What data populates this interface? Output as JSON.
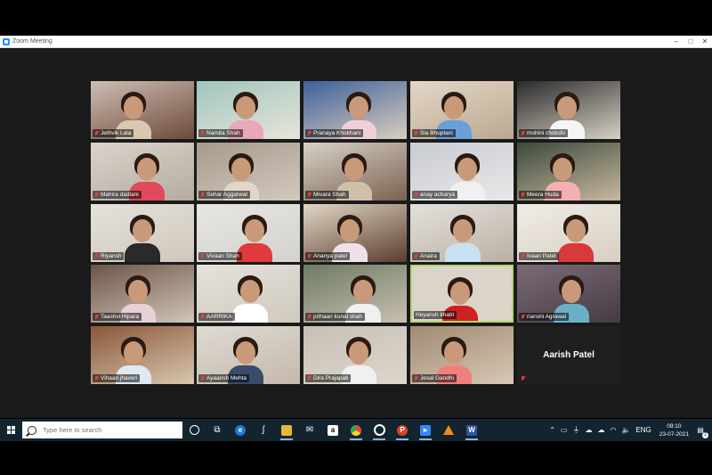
{
  "window": {
    "title": "Zoom Meeting",
    "minimize": "–",
    "maximize": "□",
    "close": "✕"
  },
  "participants": [
    {
      "name": "Jethvik Lala",
      "muted": true
    },
    {
      "name": "Namita Shah",
      "muted": true
    },
    {
      "name": "Pranaya Khokhani",
      "muted": true
    },
    {
      "name": "Sia Bhuptani",
      "muted": true
    },
    {
      "name": "mohini chokshi",
      "muted": true
    },
    {
      "name": "Mahira dadlani",
      "muted": true
    },
    {
      "name": "Sehar Aggarwal",
      "muted": true
    },
    {
      "name": "Mivara Shah",
      "muted": true
    },
    {
      "name": "anay acharya",
      "muted": true
    },
    {
      "name": "Meera Huda",
      "muted": true
    },
    {
      "name": "Riyansh",
      "muted": true
    },
    {
      "name": "Vivaan Shah",
      "muted": true
    },
    {
      "name": "Ananya patel",
      "muted": true
    },
    {
      "name": "Anaira",
      "muted": true
    },
    {
      "name": "Ivaan Patel",
      "muted": true
    },
    {
      "name": "Taashvi Hipara",
      "muted": true
    },
    {
      "name": "AARRIKA",
      "muted": true
    },
    {
      "name": "prihaan kunal shah",
      "muted": true
    },
    {
      "name": "Heyansh khatri",
      "muted": false,
      "active_speaker": true
    },
    {
      "name": "rianshi Agrawal",
      "muted": true
    },
    {
      "name": "Vihaan jhaveri",
      "muted": true
    },
    {
      "name": "Ayaansh Mehta",
      "muted": true
    },
    {
      "name": "Dira Prajapati",
      "muted": true
    },
    {
      "name": "Jesal Gandhi",
      "muted": true
    },
    {
      "name": "Aarish Patel",
      "muted": true,
      "video_off": true
    }
  ],
  "taskbar": {
    "search_placeholder": "Type here to search",
    "icons": [
      "cortana-icon",
      "task-view-icon",
      "edge-icon",
      "app-icon",
      "file-explorer-icon",
      "mail-icon",
      "amazon-icon",
      "chrome-icon",
      "media-icon",
      "powerpoint-icon",
      "zoom-icon",
      "vlc-icon",
      "word-icon"
    ],
    "tray": {
      "language": "ENG",
      "time": "09:10",
      "date": "23-07-2021",
      "notification_count": "2"
    }
  },
  "colors": {
    "active_border": "#b7d36a",
    "mute_red": "#e8403a",
    "taskbar": "#14242f"
  }
}
